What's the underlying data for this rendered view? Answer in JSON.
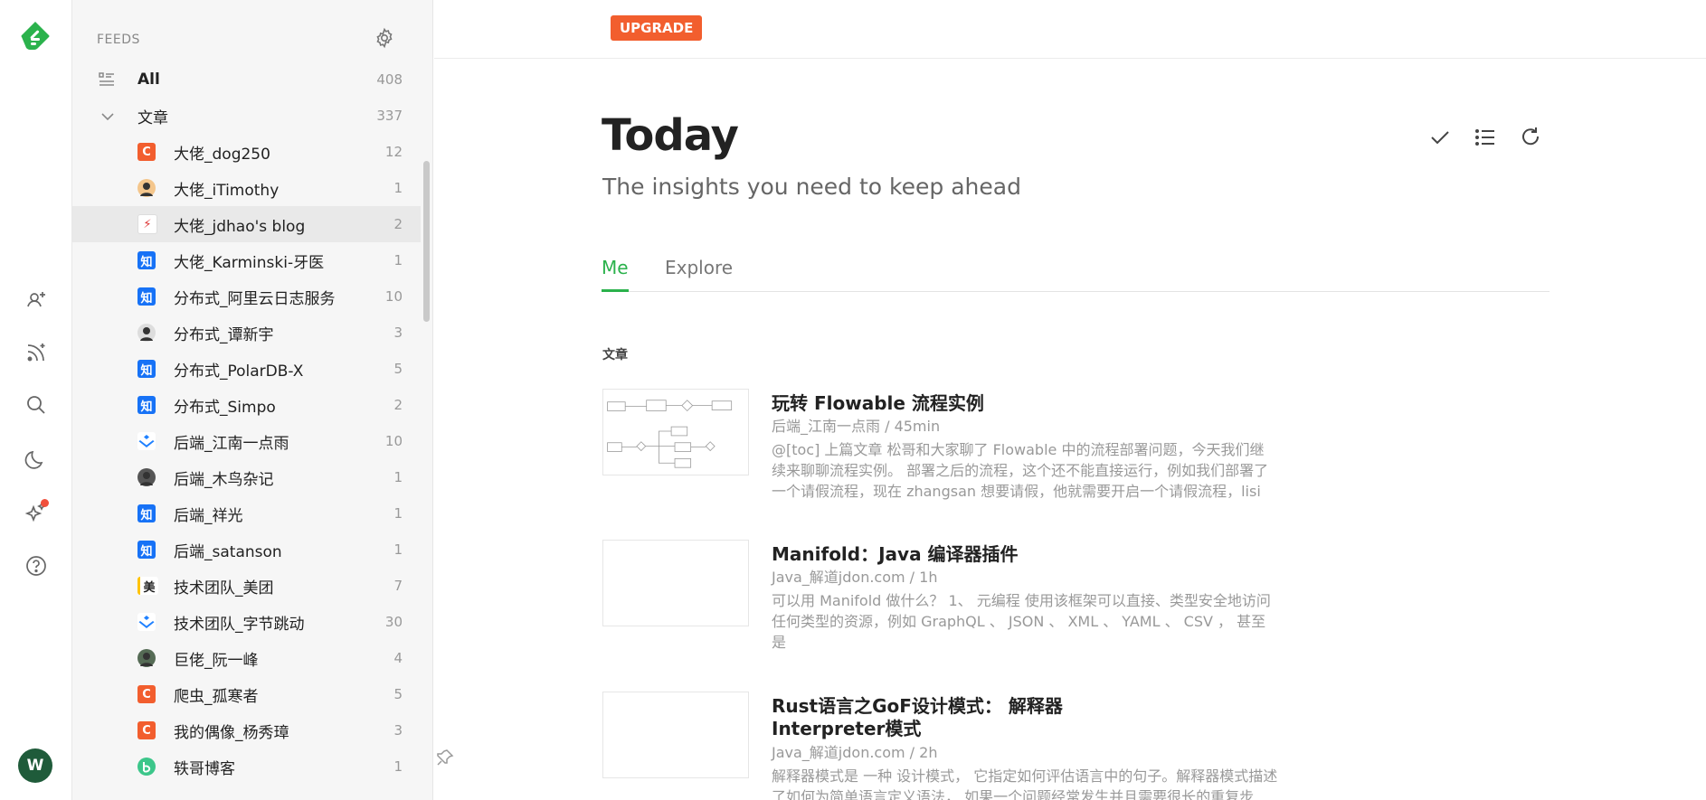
{
  "sidebar": {
    "header": "FEEDS",
    "all": {
      "label": "All",
      "count": "408"
    },
    "category": {
      "label": "文章",
      "count": "337"
    },
    "feeds": [
      {
        "name": "大佬_dog250",
        "count": "12",
        "icon": "csdn-icon",
        "color": "#f25e2e",
        "glyph": "C"
      },
      {
        "name": "大佬_iTimothy",
        "count": "1",
        "icon": "person-avatar-icon",
        "color": "#f4c68c",
        "glyph": ""
      },
      {
        "name": "大佬_jdhao's blog",
        "count": "2",
        "icon": "lightning-icon",
        "color": "#ffffff",
        "glyph": "⚡"
      },
      {
        "name": "大佬_Karminski-牙医",
        "count": "1",
        "icon": "zhihu-icon",
        "color": "#1772f6",
        "glyph": "知"
      },
      {
        "name": "分布式_阿里云日志服务",
        "count": "10",
        "icon": "zhihu-icon",
        "color": "#1772f6",
        "glyph": "知"
      },
      {
        "name": "分布式_谭新宇",
        "count": "3",
        "icon": "person-avatar-icon",
        "color": "#dddddd",
        "glyph": ""
      },
      {
        "name": "分布式_PolarDB-X",
        "count": "5",
        "icon": "zhihu-icon",
        "color": "#1772f6",
        "glyph": "知"
      },
      {
        "name": "分布式_Simpo",
        "count": "2",
        "icon": "zhihu-icon",
        "color": "#1772f6",
        "glyph": "知"
      },
      {
        "name": "后端_江南一点雨",
        "count": "10",
        "icon": "juejin-icon",
        "color": "#ffffff",
        "glyph": ""
      },
      {
        "name": "后端_木鸟杂记",
        "count": "1",
        "icon": "person-avatar-icon",
        "color": "#555555",
        "glyph": ""
      },
      {
        "name": "后端_祥光",
        "count": "1",
        "icon": "zhihu-icon",
        "color": "#1772f6",
        "glyph": "知"
      },
      {
        "name": "后端_satanson",
        "count": "1",
        "icon": "zhihu-icon",
        "color": "#1772f6",
        "glyph": "知"
      },
      {
        "name": "技术团队_美团",
        "count": "7",
        "icon": "meituan-icon",
        "color": "#ffc300",
        "glyph": "美"
      },
      {
        "name": "技术团队_字节跳动",
        "count": "30",
        "icon": "juejin-icon",
        "color": "#ffffff",
        "glyph": ""
      },
      {
        "name": "巨佬_阮一峰",
        "count": "4",
        "icon": "person-avatar-icon",
        "color": "#556b55",
        "glyph": ""
      },
      {
        "name": "爬虫_孤寒者",
        "count": "5",
        "icon": "csdn-icon",
        "color": "#f25e2e",
        "glyph": "C"
      },
      {
        "name": "我的偶像_杨秀璋",
        "count": "3",
        "icon": "csdn-icon",
        "color": "#f25e2e",
        "glyph": "C"
      },
      {
        "name": "轶哥博客",
        "count": "1",
        "icon": "blog-logo-icon",
        "color": "#3cc68a",
        "glyph": ""
      }
    ]
  },
  "rail": {
    "avatar_letter": "W"
  },
  "topbar": {
    "upgrade_label": "UPGRADE"
  },
  "main": {
    "title": "Today",
    "subtitle": "The insights you need to keep ahead",
    "tabs": [
      {
        "label": "Me"
      },
      {
        "label": "Explore"
      }
    ],
    "section_label": "文章",
    "articles": [
      {
        "title": "玩转 Flowable 流程实例",
        "meta": "后端_江南一点雨 / 45min",
        "summary": "@[toc] 上篇文章 松哥和大家聊了 Flowable 中的流程部署问题，今天我们继续来聊聊流程实例。 部署之后的流程，这个还不能直接运行，例如我们部署了一个请假流程，现在 zhangsan 想要请假，他就需要开启一个请假流程，lisi"
      },
      {
        "title": "Manifold：Java 编译器插件",
        "meta": "Java_解道jdon.com / 1h",
        "summary": "可以用 Manifold 做什么？ 1、 元编程 使用该框架可以直接、类型安全地访问任何类型的资源，例如 GraphQL 、 JSON 、 XML 、 YAML 、 CSV ， 甚至是"
      },
      {
        "title_line1": "Rust语言之GoF设计模式： 解释器",
        "title_line2": "Interpreter模式",
        "meta": "Java_解道jdon.com / 2h",
        "summary": "解释器模式是 一种 设计模式， 它指定如何评估语言中的句子。解释器模式描述了如何为简单语言定义语法， 如果一个问题经常发生并且需要很长的重复步"
      }
    ]
  }
}
